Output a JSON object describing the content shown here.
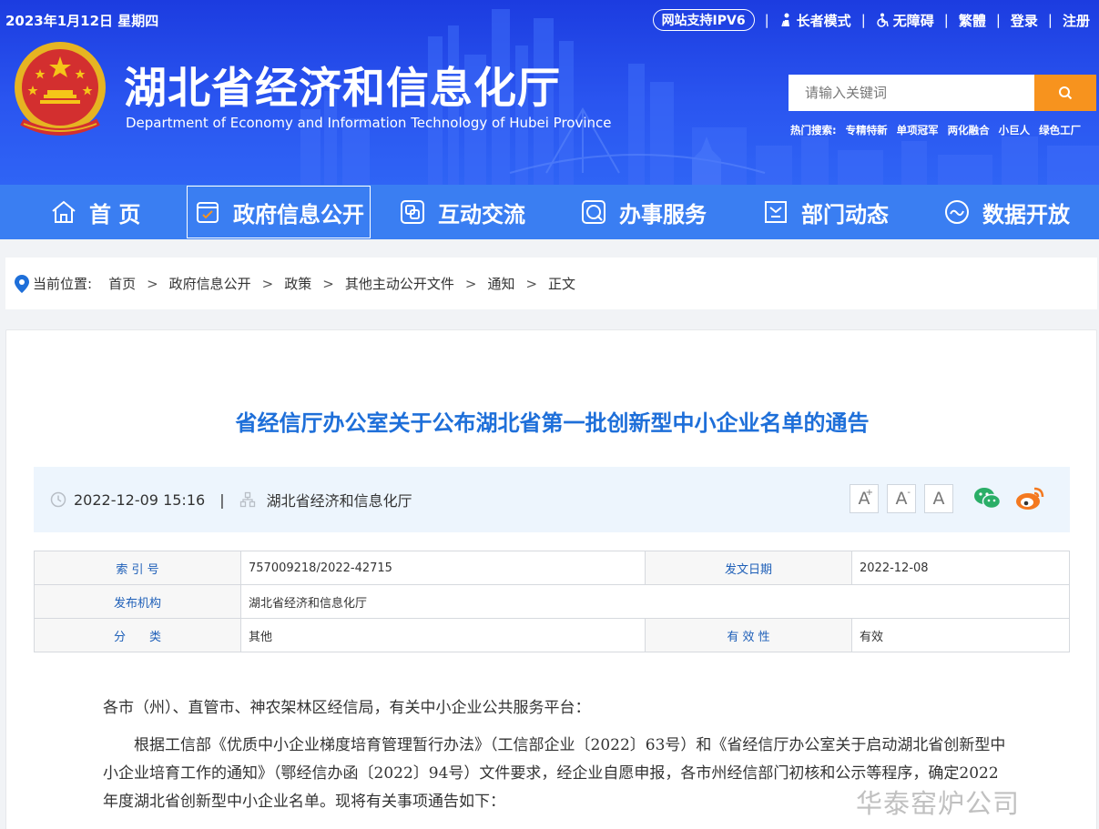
{
  "topbar": {
    "date": "2023年1月12日 星期四",
    "ipv6": "网站支持IPV6",
    "elder_mode": "长者模式",
    "accessibility": "无障碍",
    "traditional": "繁體",
    "login": "登录",
    "register": "注册"
  },
  "site": {
    "title": "湖北省经济和信息化厅",
    "subtitle": "Department of Economy and Information Technology of Hubei Province"
  },
  "search": {
    "placeholder": "请输入关键词",
    "hot_label": "热门搜索:",
    "hot_terms": [
      "专精特新",
      "单项冠军",
      "两化融合",
      "小巨人",
      "绿色工厂"
    ]
  },
  "nav": {
    "items": [
      {
        "label": "首 页",
        "icon": "home-icon"
      },
      {
        "label": "政府信息公开",
        "icon": "document-icon"
      },
      {
        "label": "互动交流",
        "icon": "chat-icon"
      },
      {
        "label": "办事服务",
        "icon": "service-icon"
      },
      {
        "label": "部门动态",
        "icon": "news-icon"
      },
      {
        "label": "数据开放",
        "icon": "data-icon"
      }
    ],
    "active_index": 1
  },
  "breadcrumb": {
    "label": "当前位置:",
    "items": [
      "首页",
      "政府信息公开",
      "政策",
      "其他主动公开文件",
      "通知",
      "正文"
    ]
  },
  "article": {
    "title": "省经信厅办公室关于公布湖北省第一批创新型中小企业名单的通告",
    "datetime": "2022-12-09 15:16",
    "source": "湖北省经济和信息化厅",
    "font_buttons": [
      "A",
      "A",
      "A"
    ],
    "font_button_marks": [
      "+",
      "-",
      ""
    ]
  },
  "info_table": {
    "index_label": "索 引 号",
    "index_value": "757009218/2022-42715",
    "date_label": "发文日期",
    "date_value": "2022-12-08",
    "org_label": "发布机构",
    "org_value": "湖北省经济和信息化厅",
    "category_label": "分　　类",
    "category_value": "其他",
    "validity_label": "有 效 性",
    "validity_value": "有效"
  },
  "body": {
    "salutation": "各市（州）、直管市、神农架林区经信局，有关中小企业公共服务平台：",
    "paragraph1": "根据工信部《优质中小企业梯度培育管理暂行办法》（工信部企业〔2022〕63号）和《省经信厅办公室关于启动湖北省创新型中小企业培育工作的通知》（鄂经信办函〔2022〕94号）文件要求，经企业自愿申报，各市州经信部门初核和公示等程序，确定2022年度湖北省创新型中小企业名单。现将有关事项通告如下："
  },
  "watermark": "华泰窑炉公司",
  "colors": {
    "header_blue": "#2a55f0",
    "nav_blue": "#3a7ef2",
    "search_orange": "#f7931e",
    "title_blue": "#1e6fd9"
  }
}
